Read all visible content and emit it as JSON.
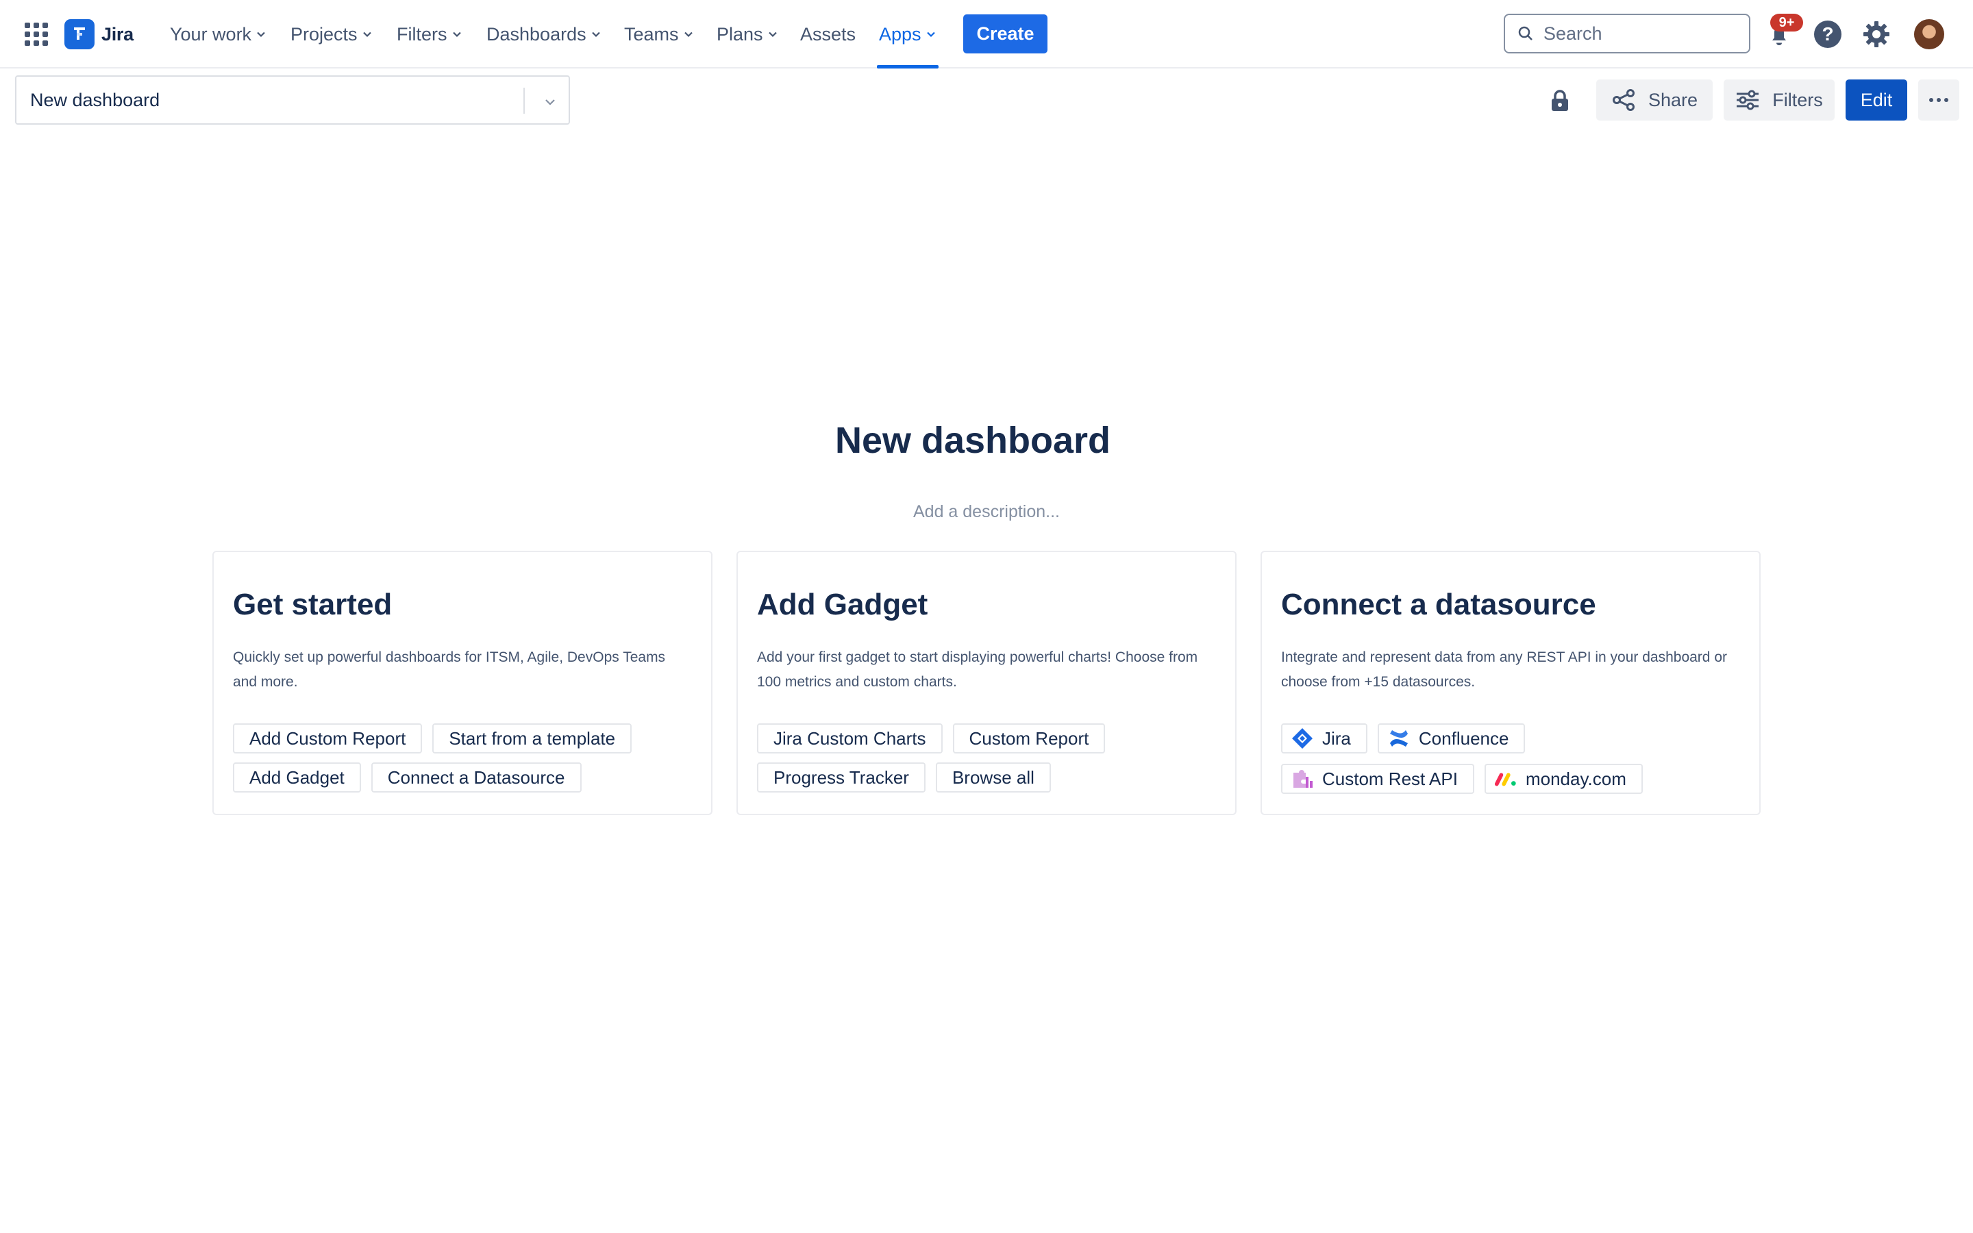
{
  "nav": {
    "logo_text": "Jira",
    "items": [
      {
        "label": "Your work"
      },
      {
        "label": "Projects"
      },
      {
        "label": "Filters"
      },
      {
        "label": "Dashboards"
      },
      {
        "label": "Teams"
      },
      {
        "label": "Plans"
      },
      {
        "label": "Assets"
      },
      {
        "label": "Apps"
      }
    ],
    "create_label": "Create",
    "search_placeholder": "Search",
    "notification_badge": "9+",
    "help_glyph": "?"
  },
  "dashboard": {
    "selected": "New dashboard",
    "share_label": "Share",
    "filters_label": "Filters",
    "edit_label": "Edit",
    "title": "New dashboard",
    "description_placeholder": "Add a description..."
  },
  "cards": {
    "get_started": {
      "title": "Get started",
      "text": "Quickly set up powerful dashboards for ITSM, Agile, DevOps Teams and more.",
      "row1": [
        "Add Custom Report",
        "Start from a template"
      ],
      "row2": [
        "Add Gadget",
        "Connect a Datasource"
      ]
    },
    "add_gadget": {
      "title": "Add Gadget",
      "text": "Add your first gadget to start displaying powerful charts! Choose from 100 metrics and custom charts.",
      "row1": [
        "Jira Custom Charts",
        "Custom Report"
      ],
      "row2": [
        "Progress Tracker",
        "Browse all"
      ]
    },
    "datasource": {
      "title": "Connect a datasource",
      "text": "Integrate and represent data from any REST API in your dashboard or choose from +15 datasources.",
      "row1": [
        "Jira",
        "Confluence"
      ],
      "row2": [
        "Custom Rest API",
        "monday.com"
      ]
    }
  },
  "colors": {
    "primary": "#1d6ae5",
    "edit": "#0c53bf",
    "active_nav": "#0c66e4",
    "badge": "#c9372c"
  }
}
